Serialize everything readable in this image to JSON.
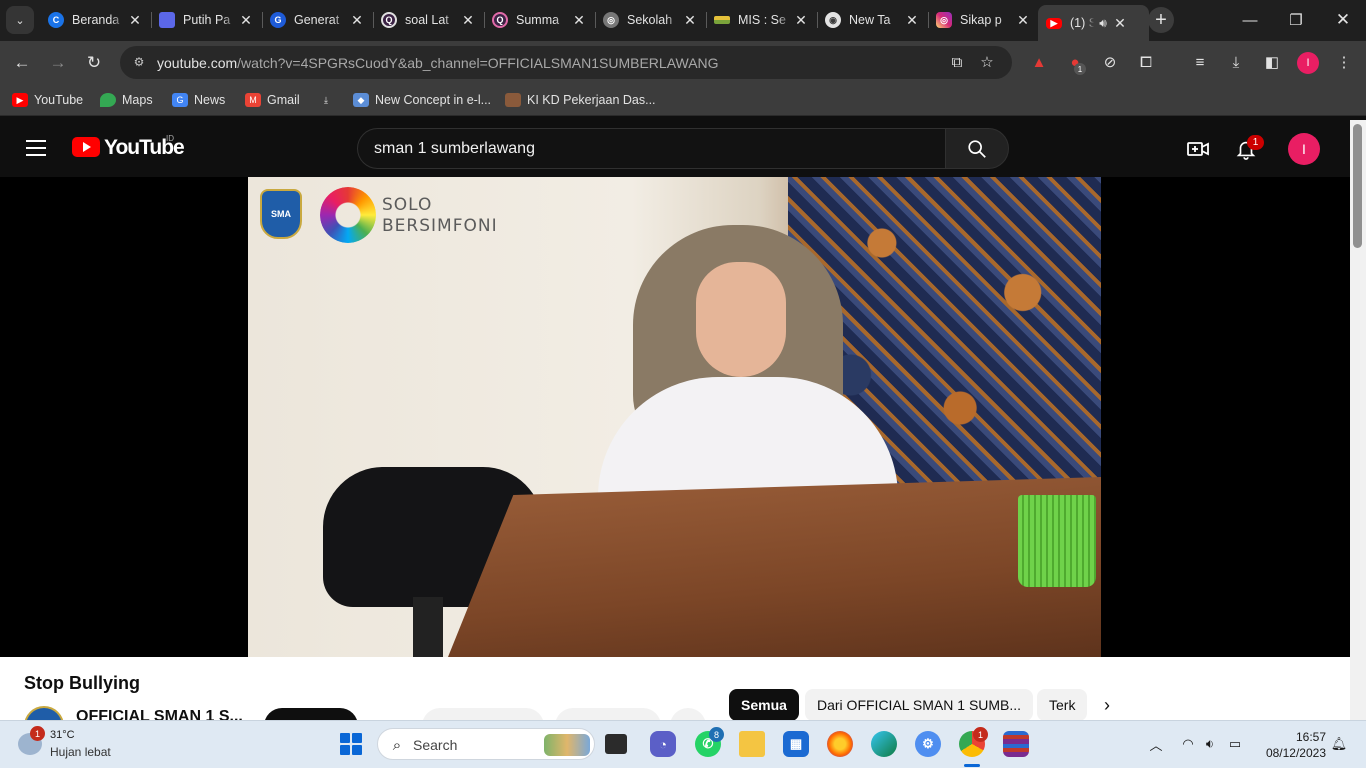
{
  "browser": {
    "tabs": [
      {
        "title": "Beranda",
        "favicon": "c-circle-icon",
        "color": "#1a73e8"
      },
      {
        "title": "Putih Pa",
        "favicon": "doc-icon",
        "color": "#5b67e8"
      },
      {
        "title": "Generat",
        "favicon": "g-logo-icon",
        "color": "#1e5bd8"
      },
      {
        "title": "soal Lat",
        "favicon": "q-icon",
        "color": "#3b2244"
      },
      {
        "title": "Summa",
        "favicon": "q-icon",
        "color": "#3b2244"
      },
      {
        "title": "Sekolah",
        "favicon": "globe-icon",
        "color": "#777777"
      },
      {
        "title": "MIS : Se",
        "favicon": "flag-icon",
        "color": "#7aa33a"
      },
      {
        "title": "New Ta",
        "favicon": "chrome-icon",
        "color": "#e3e3e3"
      },
      {
        "title": "Sikap p",
        "favicon": "instagram-icon",
        "color": "#d62976"
      },
      {
        "title": "(1) S",
        "favicon": "youtube-icon",
        "color": "#ff0000"
      }
    ],
    "url_host": "youtube.com",
    "url_rest": "/watch?v=4SPGRsCuodY&ab_channel=OFFICIALSMAN1SUMBERLAWANG",
    "extension_badge": "1",
    "profile_initial": "I",
    "bookmarks": [
      {
        "label": "YouTube",
        "icon": "youtube-icon",
        "color": "#ff0000"
      },
      {
        "label": "Maps",
        "icon": "maps-pin-icon",
        "color": "#34a853"
      },
      {
        "label": "News",
        "icon": "news-icon",
        "color": "#4285f4"
      },
      {
        "label": "Gmail",
        "icon": "gmail-icon",
        "color": "#ea4335"
      },
      {
        "label": "",
        "icon": "download-icon",
        "color": "#e3e3e3"
      },
      {
        "label": "New Concept in e-l...",
        "icon": "moodle-icon",
        "color": "#5b8dd6"
      },
      {
        "label": "KI KD Pekerjaan Das...",
        "icon": "page-thumb-icon",
        "color": "#8a5a3b"
      }
    ]
  },
  "youtube": {
    "logo_text": "YouTube",
    "region": "ID",
    "search_query": "sman 1 sumberlawang",
    "notification_count": "1",
    "account_initial": "I",
    "video_overlay": {
      "school_logo_text": "SMA",
      "brand_line1": "SOLO",
      "brand_line2": "BERSIMFONI"
    },
    "video_title": "Stop Bullying",
    "channel_name": "OFFICIAL SMAN 1 S...",
    "chips": [
      "Semua",
      "Dari OFFICIAL SMAN 1 SUMB...",
      "Terk"
    ]
  },
  "taskbar": {
    "weather_badge": "1",
    "temperature": "31°C",
    "weather_desc": "Hujan lebat",
    "search_placeholder": "Search",
    "whatsapp_badge": "8",
    "chrome_badge": "1",
    "time": "16:57",
    "date": "08/12/2023"
  }
}
